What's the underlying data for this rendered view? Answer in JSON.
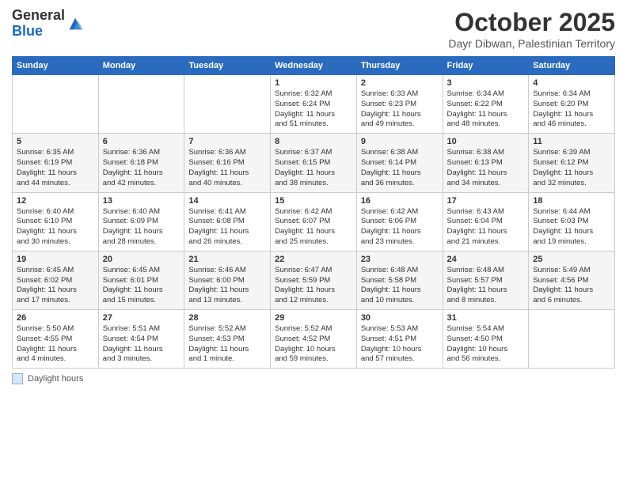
{
  "header": {
    "logo_general": "General",
    "logo_blue": "Blue",
    "month": "October 2025",
    "location": "Dayr Dibwan, Palestinian Territory"
  },
  "weekdays": [
    "Sunday",
    "Monday",
    "Tuesday",
    "Wednesday",
    "Thursday",
    "Friday",
    "Saturday"
  ],
  "weeks": [
    [
      {
        "day": "",
        "info": ""
      },
      {
        "day": "",
        "info": ""
      },
      {
        "day": "",
        "info": ""
      },
      {
        "day": "1",
        "info": "Sunrise: 6:32 AM\nSunset: 6:24 PM\nDaylight: 11 hours\nand 51 minutes."
      },
      {
        "day": "2",
        "info": "Sunrise: 6:33 AM\nSunset: 6:23 PM\nDaylight: 11 hours\nand 49 minutes."
      },
      {
        "day": "3",
        "info": "Sunrise: 6:34 AM\nSunset: 6:22 PM\nDaylight: 11 hours\nand 48 minutes."
      },
      {
        "day": "4",
        "info": "Sunrise: 6:34 AM\nSunset: 6:20 PM\nDaylight: 11 hours\nand 46 minutes."
      }
    ],
    [
      {
        "day": "5",
        "info": "Sunrise: 6:35 AM\nSunset: 6:19 PM\nDaylight: 11 hours\nand 44 minutes."
      },
      {
        "day": "6",
        "info": "Sunrise: 6:36 AM\nSunset: 6:18 PM\nDaylight: 11 hours\nand 42 minutes."
      },
      {
        "day": "7",
        "info": "Sunrise: 6:36 AM\nSunset: 6:16 PM\nDaylight: 11 hours\nand 40 minutes."
      },
      {
        "day": "8",
        "info": "Sunrise: 6:37 AM\nSunset: 6:15 PM\nDaylight: 11 hours\nand 38 minutes."
      },
      {
        "day": "9",
        "info": "Sunrise: 6:38 AM\nSunset: 6:14 PM\nDaylight: 11 hours\nand 36 minutes."
      },
      {
        "day": "10",
        "info": "Sunrise: 6:38 AM\nSunset: 6:13 PM\nDaylight: 11 hours\nand 34 minutes."
      },
      {
        "day": "11",
        "info": "Sunrise: 6:39 AM\nSunset: 6:12 PM\nDaylight: 11 hours\nand 32 minutes."
      }
    ],
    [
      {
        "day": "12",
        "info": "Sunrise: 6:40 AM\nSunset: 6:10 PM\nDaylight: 11 hours\nand 30 minutes."
      },
      {
        "day": "13",
        "info": "Sunrise: 6:40 AM\nSunset: 6:09 PM\nDaylight: 11 hours\nand 28 minutes."
      },
      {
        "day": "14",
        "info": "Sunrise: 6:41 AM\nSunset: 6:08 PM\nDaylight: 11 hours\nand 26 minutes."
      },
      {
        "day": "15",
        "info": "Sunrise: 6:42 AM\nSunset: 6:07 PM\nDaylight: 11 hours\nand 25 minutes."
      },
      {
        "day": "16",
        "info": "Sunrise: 6:42 AM\nSunset: 6:06 PM\nDaylight: 11 hours\nand 23 minutes."
      },
      {
        "day": "17",
        "info": "Sunrise: 6:43 AM\nSunset: 6:04 PM\nDaylight: 11 hours\nand 21 minutes."
      },
      {
        "day": "18",
        "info": "Sunrise: 6:44 AM\nSunset: 6:03 PM\nDaylight: 11 hours\nand 19 minutes."
      }
    ],
    [
      {
        "day": "19",
        "info": "Sunrise: 6:45 AM\nSunset: 6:02 PM\nDaylight: 11 hours\nand 17 minutes."
      },
      {
        "day": "20",
        "info": "Sunrise: 6:45 AM\nSunset: 6:01 PM\nDaylight: 11 hours\nand 15 minutes."
      },
      {
        "day": "21",
        "info": "Sunrise: 6:46 AM\nSunset: 6:00 PM\nDaylight: 11 hours\nand 13 minutes."
      },
      {
        "day": "22",
        "info": "Sunrise: 6:47 AM\nSunset: 5:59 PM\nDaylight: 11 hours\nand 12 minutes."
      },
      {
        "day": "23",
        "info": "Sunrise: 6:48 AM\nSunset: 5:58 PM\nDaylight: 11 hours\nand 10 minutes."
      },
      {
        "day": "24",
        "info": "Sunrise: 6:48 AM\nSunset: 5:57 PM\nDaylight: 11 hours\nand 8 minutes."
      },
      {
        "day": "25",
        "info": "Sunrise: 5:49 AM\nSunset: 4:56 PM\nDaylight: 11 hours\nand 6 minutes."
      }
    ],
    [
      {
        "day": "26",
        "info": "Sunrise: 5:50 AM\nSunset: 4:55 PM\nDaylight: 11 hours\nand 4 minutes."
      },
      {
        "day": "27",
        "info": "Sunrise: 5:51 AM\nSunset: 4:54 PM\nDaylight: 11 hours\nand 3 minutes."
      },
      {
        "day": "28",
        "info": "Sunrise: 5:52 AM\nSunset: 4:53 PM\nDaylight: 11 hours\nand 1 minute."
      },
      {
        "day": "29",
        "info": "Sunrise: 5:52 AM\nSunset: 4:52 PM\nDaylight: 10 hours\nand 59 minutes."
      },
      {
        "day": "30",
        "info": "Sunrise: 5:53 AM\nSunset: 4:51 PM\nDaylight: 10 hours\nand 57 minutes."
      },
      {
        "day": "31",
        "info": "Sunrise: 5:54 AM\nSunset: 4:50 PM\nDaylight: 10 hours\nand 56 minutes."
      },
      {
        "day": "",
        "info": ""
      }
    ]
  ],
  "legend": {
    "label": "Daylight hours"
  }
}
